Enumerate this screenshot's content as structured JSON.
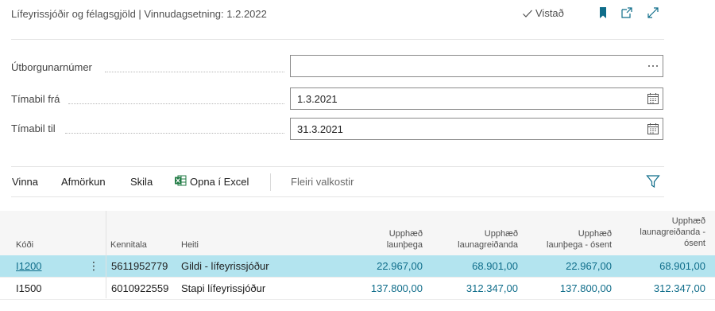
{
  "header": {
    "title": "Lífeyrissjóðir og félagsgjöld | Vinnudagsetning: 1.2.2022",
    "saved_label": "Vistað",
    "icons": [
      "bookmark-icon",
      "open-new-window-icon",
      "expand-icon"
    ]
  },
  "fields": [
    {
      "label": "Útborgunarnúmer",
      "value": "",
      "button": "ellipsis"
    },
    {
      "label": "Tímabil frá",
      "value": "1.3.2021",
      "button": "calendar-icon"
    },
    {
      "label": "Tímabil til",
      "value": "31.3.2021",
      "button": "calendar-icon"
    }
  ],
  "actions": {
    "vinna": "Vinna",
    "afmorkun": "Afmörkun",
    "skila": "Skila",
    "excel": "Opna í Excel",
    "more": "Fleiri valkostir"
  },
  "table": {
    "headers": {
      "kodi": "Kóði",
      "kennitala": "Kennitala",
      "heiti": "Heiti",
      "upp_launthega": [
        "Upphæð",
        "launþega"
      ],
      "upp_launagreidanda": [
        "Upphæð",
        "launagreiðanda"
      ],
      "upp_launthega_osent": [
        "Upphæð",
        "launþega - ósent"
      ],
      "upp_launagreidanda_osent": [
        "Upphæð",
        "launagreiðanda -",
        "ósent"
      ]
    },
    "rows": [
      {
        "kodi": "I1200",
        "kennitala": "5611952779",
        "heiti": "Gildi - lífeyrissjóður",
        "a": "22.967,00",
        "b": "68.901,00",
        "c": "22.967,00",
        "d": "68.901,00"
      },
      {
        "kodi": "I1500",
        "kennitala": "6010922559",
        "heiti": "Stapi lífeyrissjóður",
        "a": "137.800,00",
        "b": "312.347,00",
        "c": "137.800,00",
        "d": "312.347,00"
      }
    ]
  },
  "colors": {
    "accent": "#0f6d8a",
    "selected_row": "#b3e4ef",
    "excel": "#1f7a43"
  }
}
